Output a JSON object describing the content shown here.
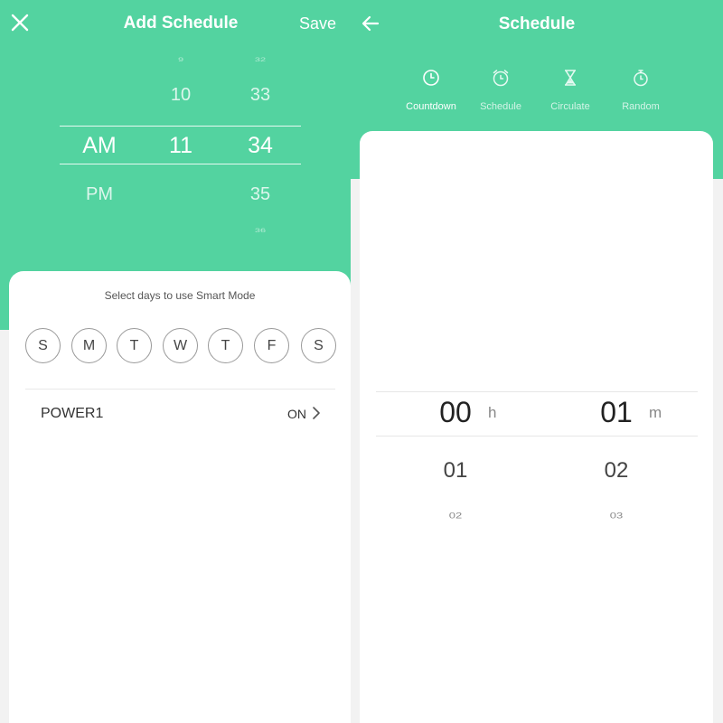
{
  "add_schedule": {
    "title": "Add Schedule",
    "save_label": "Save",
    "time_picker": {
      "ampm": {
        "selected": "AM",
        "below": "PM"
      },
      "hour": {
        "above": "10",
        "selected": "11",
        "far_above": "9"
      },
      "minute": {
        "far_above": "32",
        "above": "33",
        "selected": "34",
        "below": "35",
        "far_below": "36"
      }
    },
    "days_label": "Select days to use Smart Mode",
    "days": [
      "S",
      "M",
      "T",
      "W",
      "T",
      "F",
      "S"
    ],
    "power": {
      "label": "POWER1",
      "value": "ON"
    }
  },
  "schedule": {
    "title": "Schedule",
    "tabs": [
      {
        "label": "Countdown",
        "icon": "clock-icon",
        "active": true
      },
      {
        "label": "Schedule",
        "icon": "alarm-clock-icon",
        "active": false
      },
      {
        "label": "Circulate",
        "icon": "hourglass-icon",
        "active": false
      },
      {
        "label": "Random",
        "icon": "stopwatch-icon",
        "active": false
      }
    ],
    "hours": {
      "selected": "00",
      "next": "01",
      "far": "02",
      "unit": "h"
    },
    "minutes": {
      "selected": "01",
      "next": "02",
      "far": "03",
      "unit": "m"
    }
  },
  "colors": {
    "accent": "#53d3a0",
    "card": "#ffffff",
    "background_gray": "#f2f2f2"
  }
}
